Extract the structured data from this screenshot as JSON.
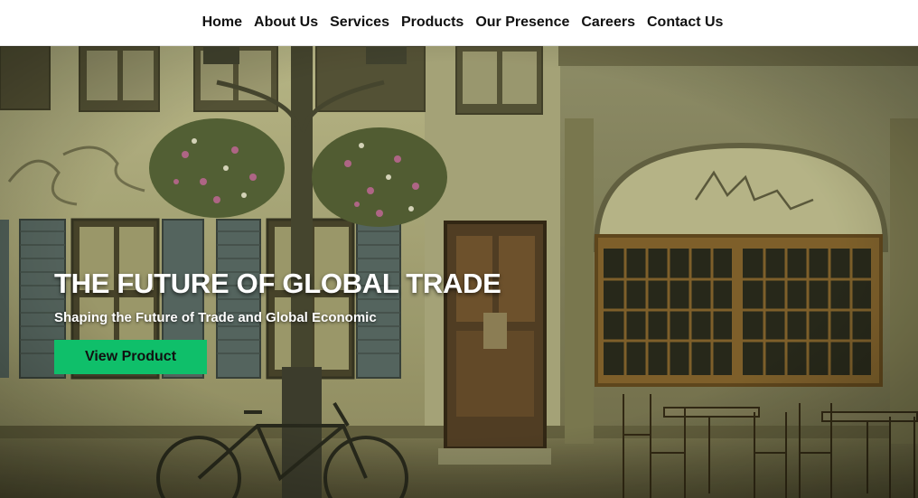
{
  "nav": {
    "items": [
      {
        "label": "Home"
      },
      {
        "label": "About Us"
      },
      {
        "label": "Services"
      },
      {
        "label": "Products"
      },
      {
        "label": "Our Presence"
      },
      {
        "label": "Careers"
      },
      {
        "label": "Contact Us"
      }
    ]
  },
  "hero": {
    "title": "THE FUTURE OF GLOBAL TRADE",
    "subtitle": "Shaping the Future of Trade and Global Economic",
    "button_label": "View Product",
    "button_color": "#0fbf6a",
    "background": "street-cafe-photo"
  }
}
